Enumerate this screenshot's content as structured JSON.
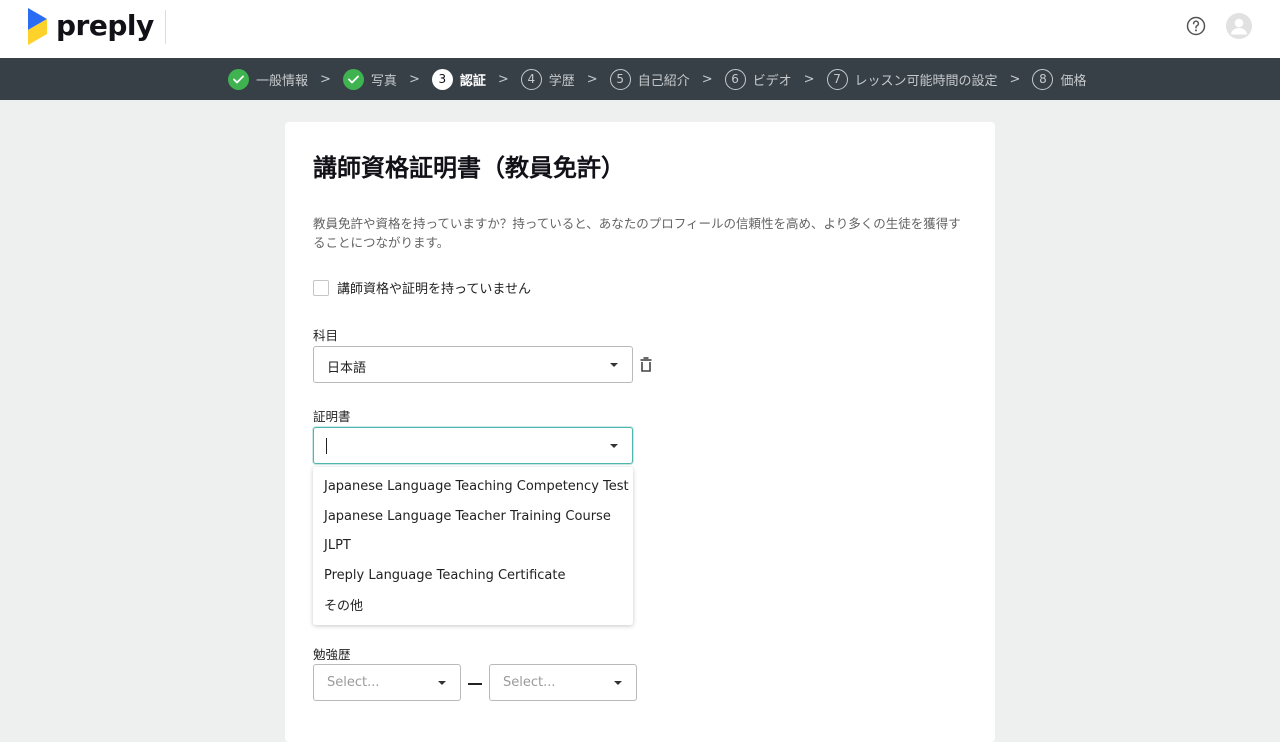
{
  "header": {
    "logo_text": "preply",
    "icons": [
      "preply-logo-icon",
      "help-icon",
      "avatar-icon"
    ]
  },
  "steps": [
    {
      "label": "一般情報",
      "status": "done",
      "number": ""
    },
    {
      "label": "写真",
      "status": "done",
      "number": ""
    },
    {
      "label": "認証",
      "status": "current",
      "number": "3"
    },
    {
      "label": "学歴",
      "status": "todo",
      "number": "4"
    },
    {
      "label": "自己紹介",
      "status": "todo",
      "number": "5"
    },
    {
      "label": "ビデオ",
      "status": "todo",
      "number": "6"
    },
    {
      "label": "レッスン可能時間の設定",
      "status": "todo",
      "number": "7"
    },
    {
      "label": "価格",
      "status": "todo",
      "number": "8"
    }
  ],
  "step_separator": ">",
  "form": {
    "title": "講師資格証明書（教員免許）",
    "description": "教員免許や資格を持っていますか？持っていると、あなたのプロフィールの信頼性を高め、より多くの生徒を獲得することにつながります。",
    "no_certificate_label": "講師資格や証明を持っていません",
    "no_certificate_checked": false,
    "subject_label": "科目",
    "subject_value": "日本語",
    "certificate_label": "証明書",
    "certificate_value": "",
    "certificate_options": [
      "Japanese Language Teaching Competency Test",
      "Japanese Language Teacher Training Course",
      "JLPT",
      "Preply Language Teaching Certificate",
      "その他"
    ],
    "study_label": "勉強歴",
    "study_from_placeholder": "Select...",
    "study_to_placeholder": "Select..."
  },
  "colors": {
    "step_bar": "#384047",
    "done_check": "#3fb34f",
    "focus_border": "#4fb7b0",
    "background": "#eef0ef",
    "logo_blue": "#2a6df4",
    "logo_yellow": "#ffd12b"
  }
}
